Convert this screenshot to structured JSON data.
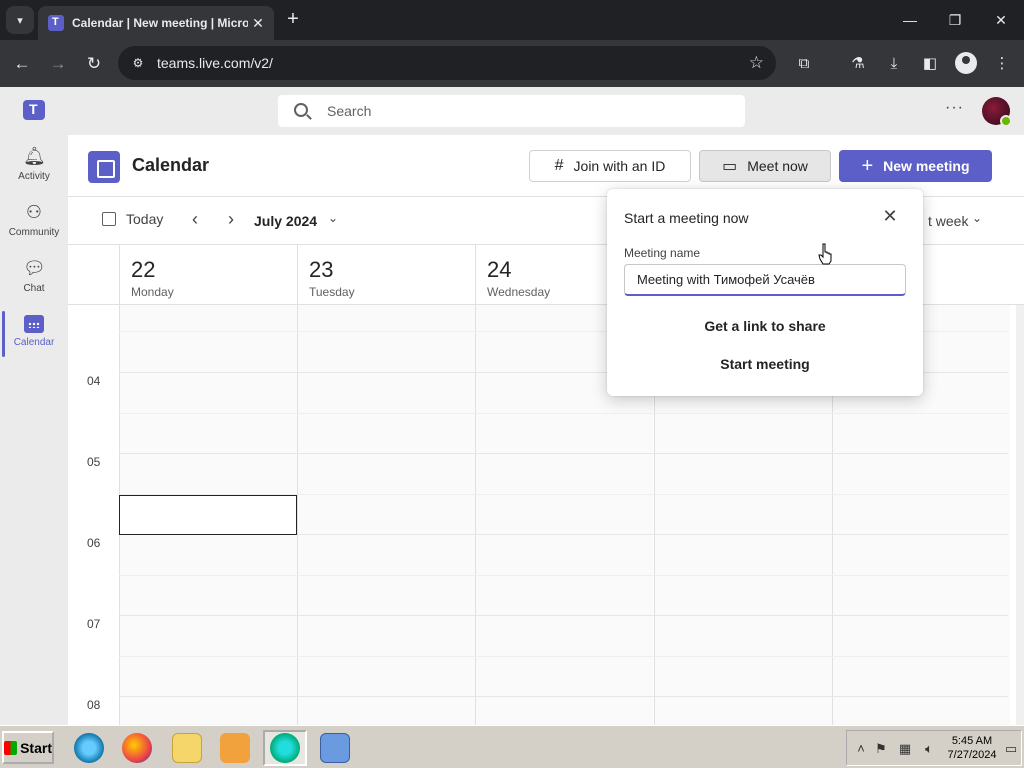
{
  "browser": {
    "tab_title": "Calendar | New meeting | Microsoft Teams",
    "tab_close": "✕",
    "new_tab": "+",
    "url": "teams.live.com/v2/",
    "window_controls": {
      "minimize": "—",
      "maximize": "❐",
      "close": "✕"
    }
  },
  "teams": {
    "search_placeholder": "Search",
    "more": "···",
    "rail": [
      {
        "label": "Activity",
        "icon": "bell-icon"
      },
      {
        "label": "Community",
        "icon": "community-icon"
      },
      {
        "label": "Chat",
        "icon": "chat-icon"
      },
      {
        "label": "Calendar",
        "icon": "calendar-icon"
      }
    ]
  },
  "calendar": {
    "title": "Calendar",
    "join_label": "Join with an ID",
    "meet_now_label": "Meet now",
    "new_meeting_label": "New meeting",
    "today_label": "Today",
    "month_label": "July 2024",
    "view_label": "t week",
    "days": [
      {
        "num": "22",
        "name": "Monday"
      },
      {
        "num": "23",
        "name": "Tuesday"
      },
      {
        "num": "24",
        "name": "Wednesday"
      },
      {
        "num": "",
        "name": ""
      },
      {
        "num": "",
        "name": ""
      }
    ],
    "hours": [
      "04",
      "05",
      "06",
      "07",
      "08"
    ]
  },
  "popup": {
    "title": "Start a meeting now",
    "name_label": "Meeting name",
    "name_value": "Meeting with Тимофей Усачёв",
    "link_label": "Get a link to share",
    "start_label": "Start meeting"
  },
  "taskbar": {
    "start_label": "Start",
    "time": "5:45 AM",
    "date": "7/27/2024"
  },
  "colors": {
    "accent": "#5b5fc7",
    "presence": "#6bb700"
  }
}
